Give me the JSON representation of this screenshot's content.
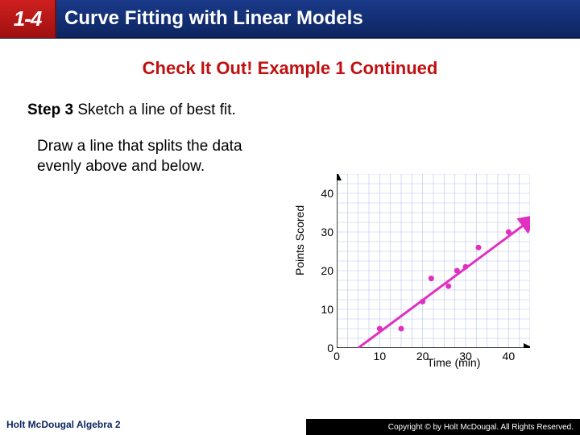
{
  "header": {
    "lesson": "1-4",
    "title": "Curve Fitting with Linear Models"
  },
  "subtitle": "Check It Out! Example 1 Continued",
  "step": {
    "boldLabel": "Step 3",
    "text": "Sketch a line of best fit."
  },
  "instruction": "Draw a line that splits the data evenly above and below.",
  "footer": {
    "left": "Holt McDougal Algebra 2",
    "right": "Copyright © by Holt McDougal. All Rights Reserved."
  },
  "chart_data": {
    "type": "scatter",
    "title": "",
    "xlabel": "Time (min)",
    "ylabel": "Points Scored",
    "xlim": [
      0,
      45
    ],
    "ylim": [
      0,
      45
    ],
    "x_ticks": [
      0,
      10,
      20,
      30,
      40
    ],
    "y_ticks": [
      0,
      10,
      20,
      30,
      40
    ],
    "grid": true,
    "points": [
      {
        "x": 10,
        "y": 5
      },
      {
        "x": 15,
        "y": 5
      },
      {
        "x": 20,
        "y": 12
      },
      {
        "x": 22,
        "y": 18
      },
      {
        "x": 26,
        "y": 16
      },
      {
        "x": 28,
        "y": 20
      },
      {
        "x": 30,
        "y": 21
      },
      {
        "x": 33,
        "y": 26
      },
      {
        "x": 40,
        "y": 30
      }
    ],
    "fit_line": {
      "x1": 5,
      "y1": 0,
      "x2": 45,
      "y2": 33,
      "color": "#e030c0"
    }
  }
}
